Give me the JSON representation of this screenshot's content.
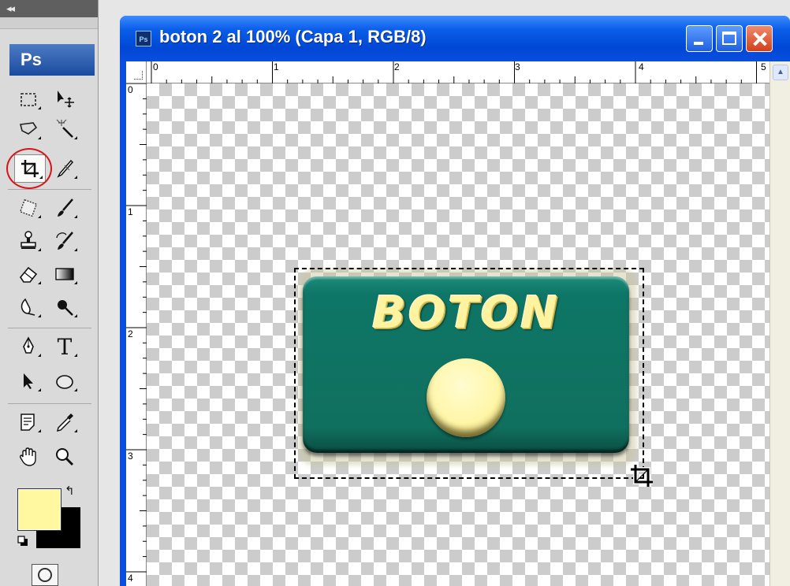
{
  "toolbox": {
    "collapse_label": "◂◂",
    "logo": "Ps",
    "tools": [
      {
        "name": "marquee-tool",
        "icon": "rect-marquee-icon"
      },
      {
        "name": "move-tool",
        "icon": "move-icon"
      },
      {
        "name": "lasso-tool",
        "icon": "lasso-icon"
      },
      {
        "name": "magic-wand-tool",
        "icon": "magic-wand-icon"
      },
      {
        "name": "crop-tool",
        "icon": "crop-icon",
        "selected": true
      },
      {
        "name": "slice-tool",
        "icon": "slice-icon"
      },
      {
        "name": "healing-brush-tool",
        "icon": "healing-brush-icon"
      },
      {
        "name": "brush-tool",
        "icon": "brush-icon"
      },
      {
        "name": "clone-stamp-tool",
        "icon": "stamp-icon"
      },
      {
        "name": "history-brush-tool",
        "icon": "history-brush-icon"
      },
      {
        "name": "eraser-tool",
        "icon": "eraser-icon"
      },
      {
        "name": "gradient-tool",
        "icon": "gradient-icon"
      },
      {
        "name": "blur-tool",
        "icon": "blur-icon"
      },
      {
        "name": "dodge-tool",
        "icon": "dodge-icon"
      },
      {
        "name": "pen-tool",
        "icon": "pen-icon"
      },
      {
        "name": "type-tool",
        "icon": "type-icon",
        "glyph": "T"
      },
      {
        "name": "path-selection-tool",
        "icon": "path-selection-icon"
      },
      {
        "name": "ellipse-tool",
        "icon": "ellipse-icon"
      },
      {
        "name": "notes-tool",
        "icon": "notes-icon"
      },
      {
        "name": "eyedropper-tool",
        "icon": "eyedropper-icon"
      },
      {
        "name": "hand-tool",
        "icon": "hand-icon"
      },
      {
        "name": "zoom-tool",
        "icon": "zoom-icon"
      }
    ],
    "foreground_color": "#fff8a0",
    "background_color": "#000000",
    "swap_glyph": "↰"
  },
  "document": {
    "title": "boton 2 al 100% (Capa 1, RGB/8)",
    "icon_label": "Ps",
    "h_ruler_labels": [
      "0",
      "1",
      "2",
      "3",
      "4",
      "5"
    ],
    "v_ruler_labels": [
      "0",
      "1",
      "2",
      "3",
      "4"
    ],
    "scroll_up_glyph": "▲"
  },
  "artwork": {
    "text": "BOTON",
    "button_color": "#10705f",
    "text_color": "#fff3a0",
    "circle_color": "#fff6a8"
  }
}
